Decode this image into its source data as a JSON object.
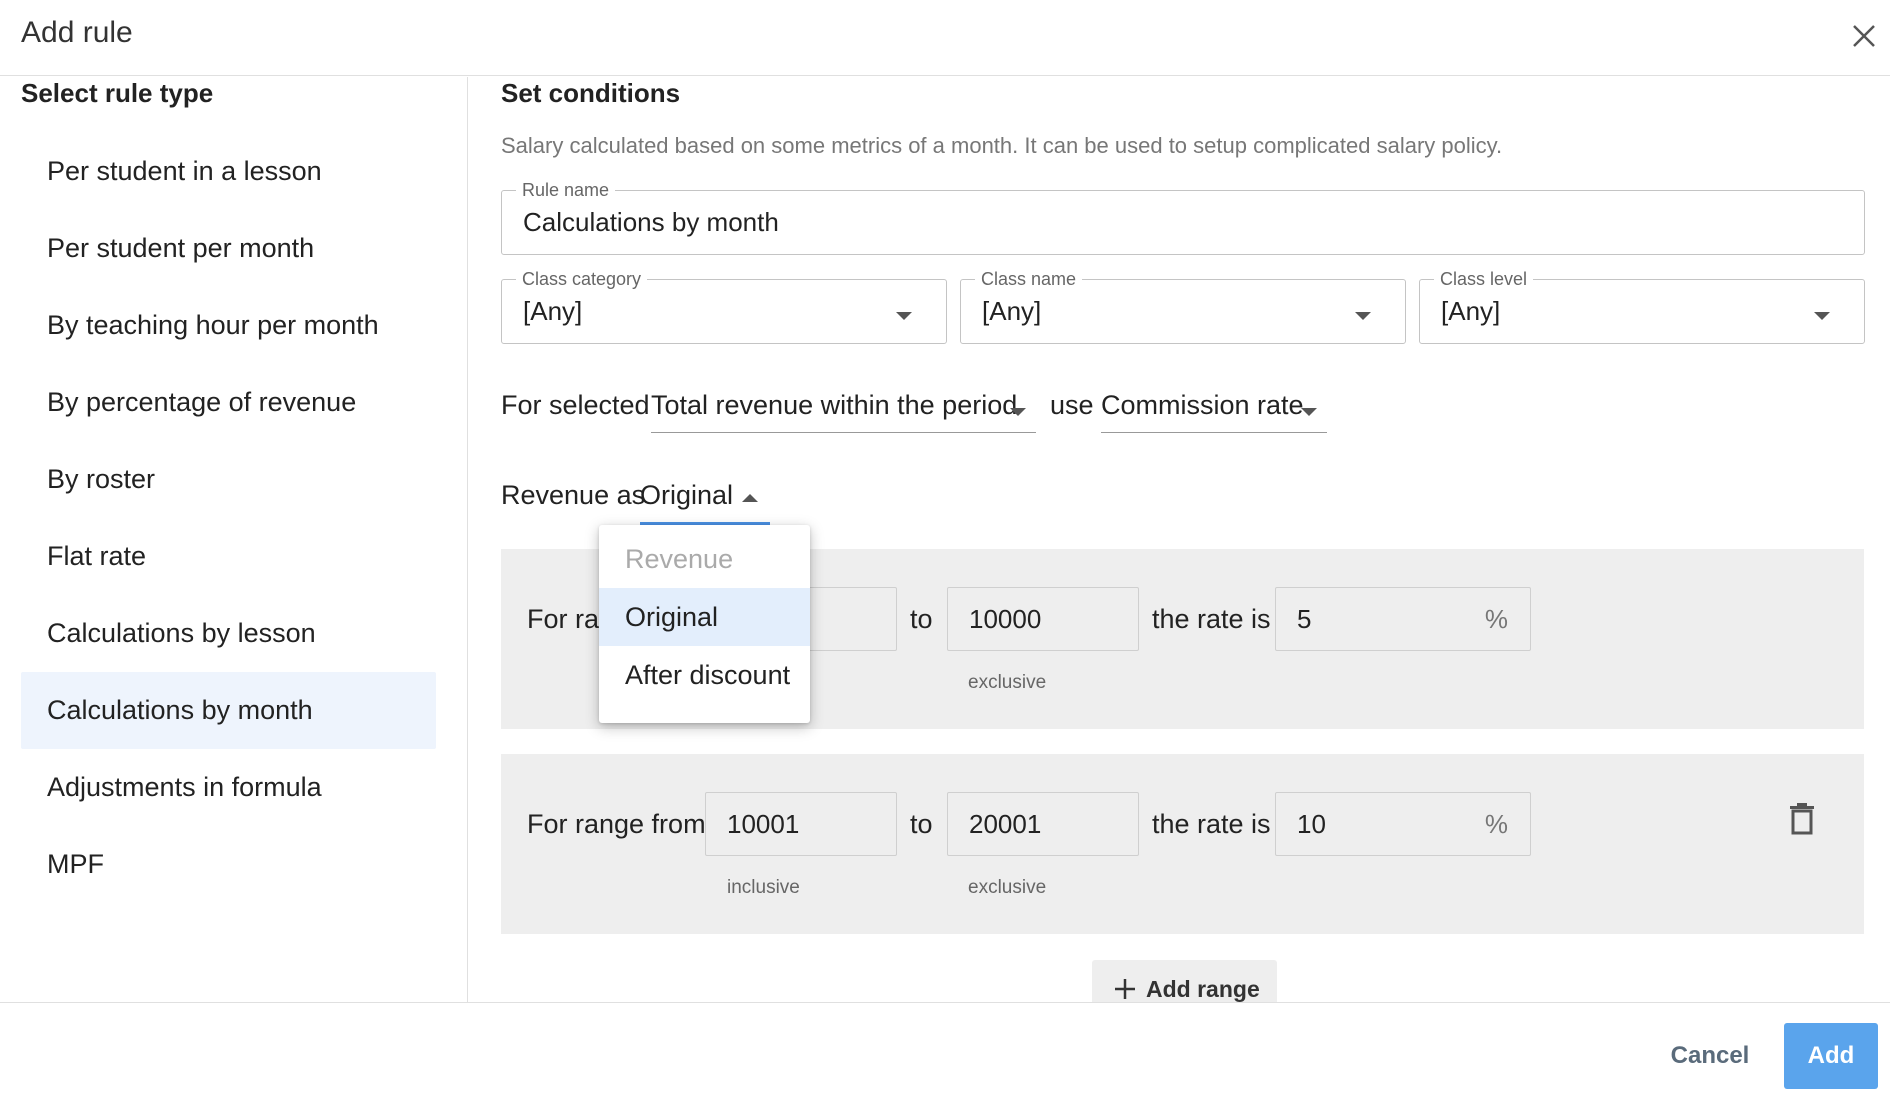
{
  "dialog": {
    "title": "Add rule"
  },
  "left": {
    "section_title": "Select rule type",
    "items": [
      {
        "label": "Per student in a lesson"
      },
      {
        "label": "Per student per month"
      },
      {
        "label": "By teaching hour per month"
      },
      {
        "label": "By percentage of revenue"
      },
      {
        "label": "By roster"
      },
      {
        "label": "Flat rate"
      },
      {
        "label": "Calculations by lesson"
      },
      {
        "label": "Calculations by month",
        "selected": true
      },
      {
        "label": "Adjustments in formula"
      },
      {
        "label": "MPF"
      }
    ]
  },
  "conditions": {
    "section_title": "Set conditions",
    "description": "Salary calculated based on some metrics of a month. It can be used to setup complicated salary policy.",
    "rule_name": {
      "label": "Rule name",
      "value": "Calculations by month"
    },
    "class_category": {
      "label": "Class category",
      "value": "[Any]"
    },
    "class_name": {
      "label": "Class name",
      "value": "[Any]"
    },
    "class_level": {
      "label": "Class level",
      "value": "[Any]"
    },
    "for_selected_label": "For selected",
    "metric_select": "Total revenue within the period",
    "use_label": "use",
    "rate_type_select": "Commission rate",
    "revenue_as_label": "Revenue as",
    "revenue_as_select": "Original",
    "revenue_menu": {
      "header": "Revenue",
      "options": [
        "Original",
        "After discount"
      ],
      "selected": "Original"
    },
    "ranges": [
      {
        "prefix": "For ran",
        "to_label": "to",
        "to_value": "10000",
        "to_helper": "exclusive",
        "rate_label": "the rate is",
        "rate_value": "5",
        "rate_suffix": "%"
      },
      {
        "prefix": "For range from",
        "from_value": "10001",
        "from_helper": "inclusive",
        "to_label": "to",
        "to_value": "20001",
        "to_helper": "exclusive",
        "rate_label": "the rate is",
        "rate_value": "10",
        "rate_suffix": "%"
      }
    ],
    "add_range_label": "Add range"
  },
  "footer": {
    "cancel_label": "Cancel",
    "add_label": "Add"
  },
  "colors": {
    "accent": "#5aa4ec",
    "selected_bg": "#eef4fd",
    "range_bg": "#eeeeee"
  }
}
